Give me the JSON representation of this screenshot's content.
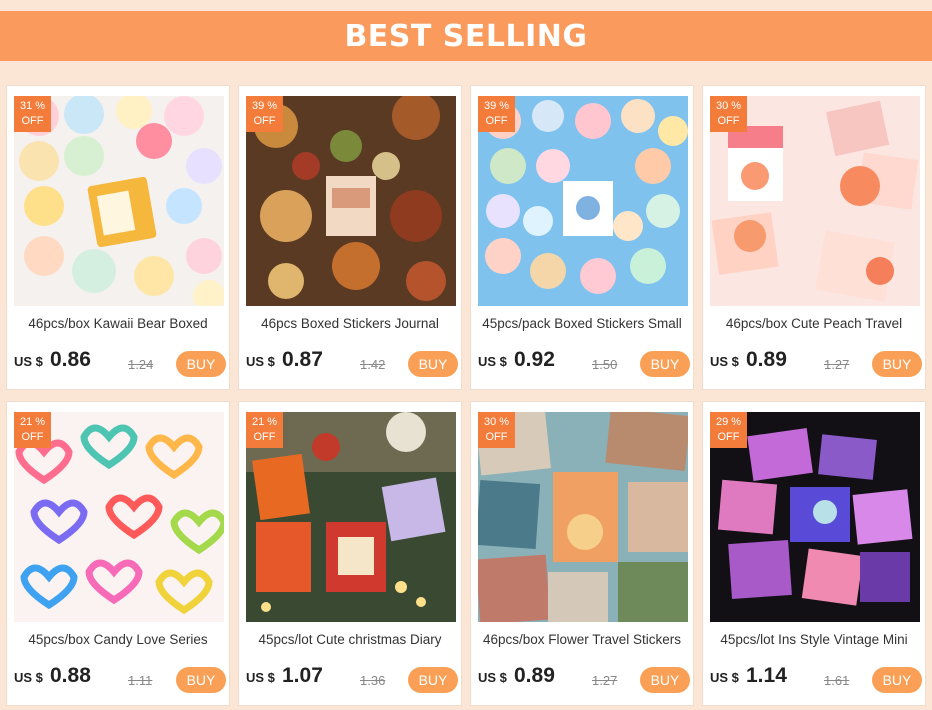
{
  "banner": {
    "title": "BEST SELLING"
  },
  "currency_label": "US $",
  "buy_label": "BUY",
  "products": [
    {
      "discount_pct": "31 %",
      "discount_off": "OFF",
      "title": "46pcs/box Kawaii Bear Boxed",
      "price": "0.86",
      "old_price": "1.24"
    },
    {
      "discount_pct": "39 %",
      "discount_off": "OFF",
      "title": "46pcs Boxed Stickers Journal",
      "price": "0.87",
      "old_price": "1.42"
    },
    {
      "discount_pct": "39 %",
      "discount_off": "OFF",
      "title": "45pcs/pack Boxed Stickers Small",
      "price": "0.92",
      "old_price": "1.50"
    },
    {
      "discount_pct": "30 %",
      "discount_off": "OFF",
      "title": "46pcs/box Cute Peach Travel",
      "price": "0.89",
      "old_price": "1.27"
    },
    {
      "discount_pct": "21 %",
      "discount_off": "OFF",
      "title": "45pcs/box Candy Love Series",
      "price": "0.88",
      "old_price": "1.11"
    },
    {
      "discount_pct": "21 %",
      "discount_off": "OFF",
      "title": "45pcs/lot Cute christmas Diary",
      "price": "1.07",
      "old_price": "1.36"
    },
    {
      "discount_pct": "30 %",
      "discount_off": "OFF",
      "title": "46pcs/box Flower Travel Stickers",
      "price": "0.89",
      "old_price": "1.27"
    },
    {
      "discount_pct": "29 %",
      "discount_off": "OFF",
      "title": "45pcs/lot Ins Style Vintage Mini",
      "price": "1.14",
      "old_price": "1.61"
    }
  ],
  "colors": {
    "page_bg": "#fbe6d6",
    "banner_bg": "#fa9a5c",
    "discount_bg": "#f47c3a",
    "buy_bg": "#f9a056"
  }
}
